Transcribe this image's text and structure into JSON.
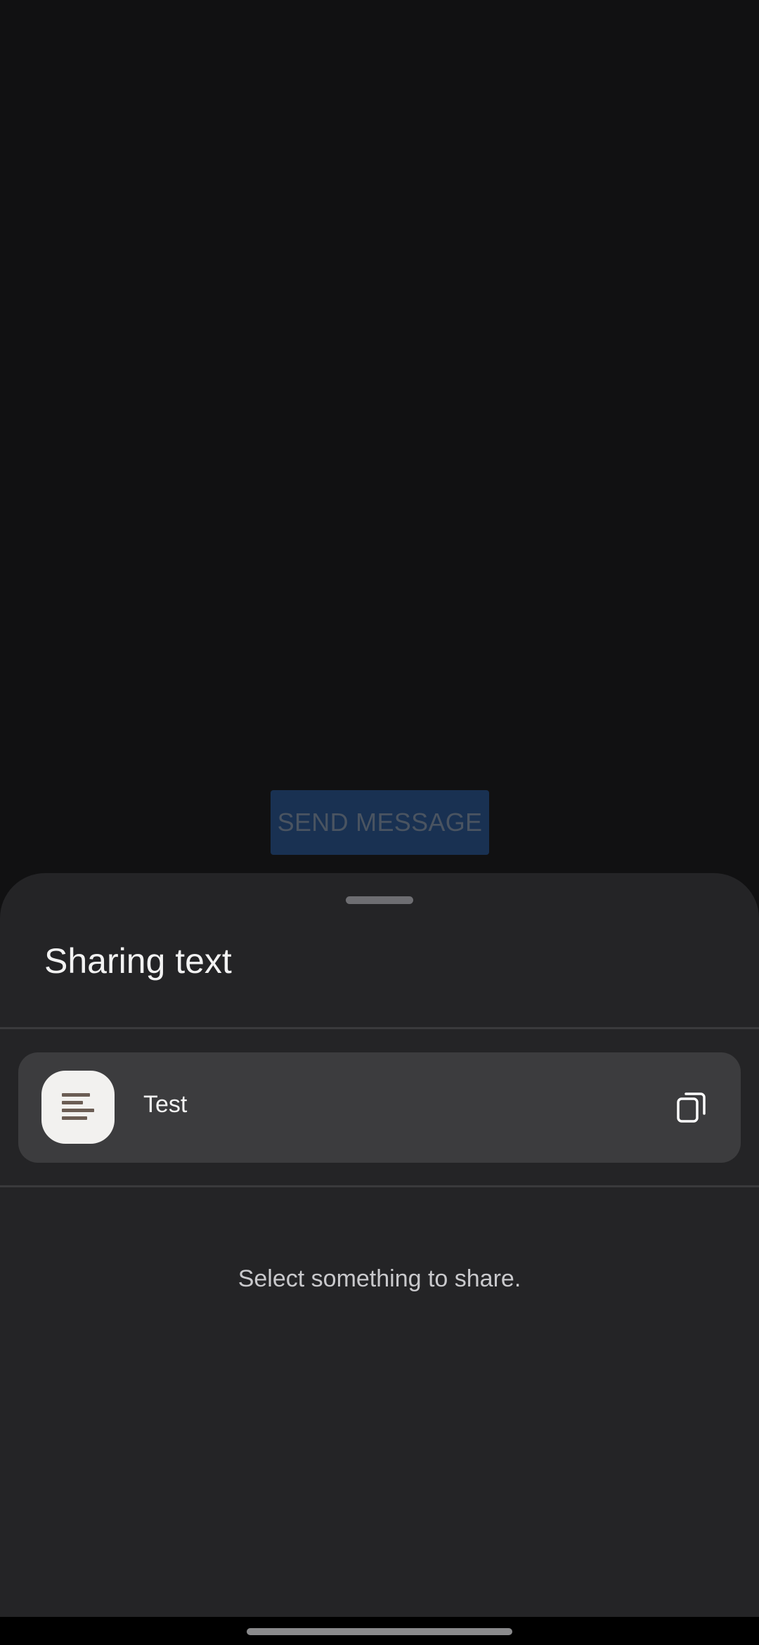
{
  "background_button": {
    "label": "SEND MESSAGE"
  },
  "share_sheet": {
    "title": "Sharing text",
    "item": {
      "label": "Test",
      "icon": "text-lines-icon",
      "action_icon": "copy-icon"
    },
    "empty_message": "Select something to share."
  },
  "colors": {
    "background": "#111112",
    "sheet": "#242426",
    "card": "#3c3c3e",
    "send_button": "#193152"
  }
}
